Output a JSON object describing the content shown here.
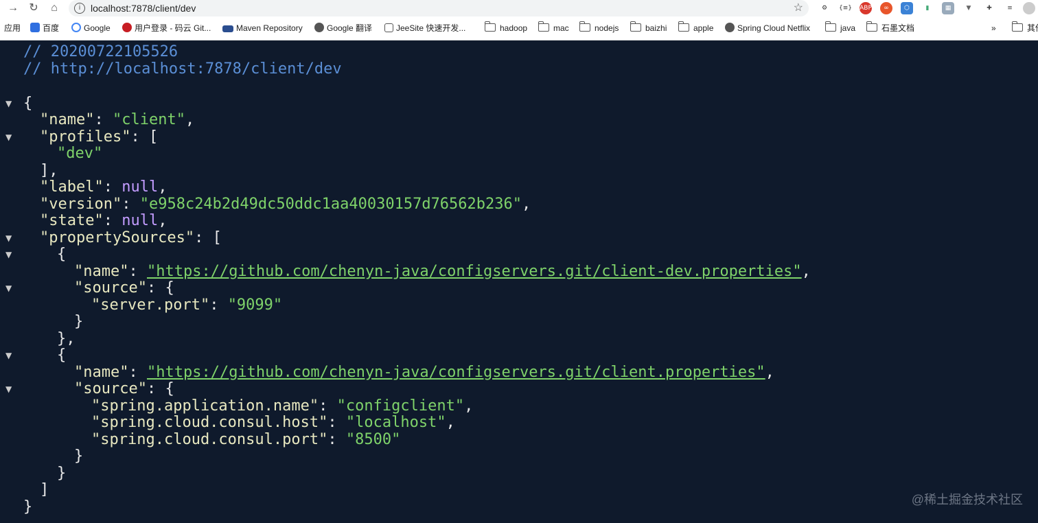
{
  "browser": {
    "url": "localhost:7878/client/dev",
    "bookmarks": [
      {
        "label": "应用"
      },
      {
        "label": "百度"
      },
      {
        "label": "Google"
      },
      {
        "label": "用户登录 - 码云 Git..."
      },
      {
        "label": "Maven Repository"
      },
      {
        "label": "Google 翻译"
      },
      {
        "label": "JeeSite 快速开发..."
      },
      {
        "label": "hadoop"
      },
      {
        "label": "mac"
      },
      {
        "label": "nodejs"
      },
      {
        "label": "baizhi"
      },
      {
        "label": "apple"
      },
      {
        "label": "Spring Cloud Netflix"
      },
      {
        "label": "java"
      },
      {
        "label": "石墨文档"
      },
      {
        "label": "»"
      },
      {
        "label": "其他"
      }
    ],
    "extensions": [
      "ABP",
      "∞",
      "{≡}"
    ],
    "colors": {
      "accent": "#1a73e8"
    }
  },
  "json_view": {
    "comment_timestamp": "// 20200722105526",
    "comment_url": "// http://localhost:7878/client/dev",
    "name_key": "\"name\"",
    "name_value": "\"client\"",
    "profiles_key": "\"profiles\"",
    "profile_0": "\"dev\"",
    "label_key": "\"label\"",
    "null_value": "null",
    "version_key": "\"version\"",
    "version_value": "\"e958c24b2d49dc50ddc1aa40030157d76562b236\"",
    "state_key": "\"state\"",
    "property_sources_key": "\"propertySources\"",
    "ps0_name_value": "\"https://github.com/chenyn-java/configservers.git/client-dev.properties\"",
    "source_key": "\"source\"",
    "server_port_key": "\"server.port\"",
    "server_port_value": "\"9099\"",
    "ps1_name_value": "\"https://github.com/chenyn-java/configservers.git/client.properties\"",
    "app_name_key": "\"spring.application.name\"",
    "app_name_value": "\"configclient\"",
    "consul_host_key": "\"spring.cloud.consul.host\"",
    "consul_host_value": "\"localhost\"",
    "consul_port_key": "\"spring.cloud.consul.port\"",
    "consul_port_value": "\"8500\"",
    "colors": {
      "background": "#0f1a2c",
      "string": "#7fd36a",
      "null": "#c39cff",
      "comment": "#5b8fd6"
    }
  },
  "watermark": "@稀土掘金技术社区"
}
